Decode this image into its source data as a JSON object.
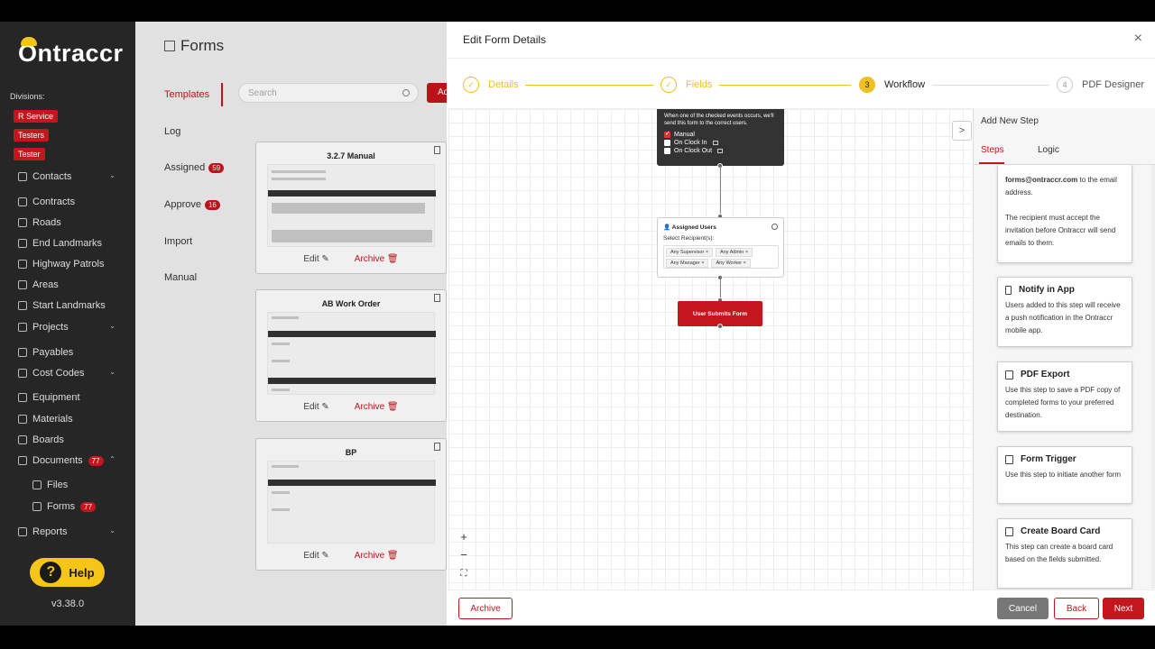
{
  "sidebar": {
    "logo": "Ontraccr",
    "divisions_label": "Divisions:",
    "divisions": [
      "R Service",
      "Testers",
      "Tester"
    ],
    "items": [
      {
        "label": "Contacts",
        "chevron": true
      },
      {
        "label": "Contracts"
      },
      {
        "label": "Roads"
      },
      {
        "label": "End Landmarks"
      },
      {
        "label": "Highway Patrols"
      },
      {
        "label": "Areas"
      },
      {
        "label": "Start Landmarks"
      },
      {
        "label": "Projects",
        "chevron": true
      },
      {
        "label": "Payables"
      },
      {
        "label": "Cost Codes",
        "chevron": true
      },
      {
        "label": "Equipment"
      },
      {
        "label": "Materials"
      },
      {
        "label": "Boards"
      },
      {
        "label": "Documents",
        "badge": "77",
        "chevron": true
      },
      {
        "label": "Files",
        "sub": true
      },
      {
        "label": "Forms",
        "badge": "77",
        "sub": true
      },
      {
        "label": "Reports",
        "chevron": true
      }
    ],
    "help_label": "Help",
    "help_q": "?",
    "version": "v3.38.0"
  },
  "forms_page": {
    "title": "Forms",
    "tabs": [
      {
        "label": "Templates",
        "active": true
      },
      {
        "label": "Log"
      },
      {
        "label": "Assigned",
        "badge": "59"
      },
      {
        "label": "Approve",
        "badge": "16"
      },
      {
        "label": "Import"
      },
      {
        "label": "Manual"
      }
    ],
    "search_placeholder": "Search",
    "add_label": "Ad",
    "cards": [
      {
        "title": "3.2.7 Manual",
        "edit": "Edit",
        "archive": "Archive"
      },
      {
        "title": "AB Work Order",
        "edit": "Edit",
        "archive": "Archive"
      },
      {
        "title": "BP",
        "edit": "Edit",
        "archive": "Archive"
      }
    ]
  },
  "modal": {
    "title": "Edit Form Details",
    "close": "×",
    "steps": [
      {
        "label": "Details",
        "marker": "✓",
        "state": "done"
      },
      {
        "label": "Fields",
        "marker": "✓",
        "state": "done"
      },
      {
        "label": "Workflow",
        "marker": "3",
        "state": "current"
      },
      {
        "label": "PDF Designer",
        "marker": "4",
        "state": "todo"
      }
    ],
    "trigger": {
      "description": "When one of the checked events occurs, we'll send this form to the correct users.",
      "options": [
        {
          "label": "Manual",
          "checked": true
        },
        {
          "label": "On Clock In",
          "checked": false
        },
        {
          "label": "On Clock Out",
          "checked": false
        }
      ]
    },
    "assigned_users": {
      "title": "Assigned Users",
      "subtitle": "Select Recipient(s):",
      "tags": [
        "Any Supervisor ×",
        "Any Admin ×",
        "Any Manager ×",
        "Any Worker ×"
      ]
    },
    "submit_node": "User Submits Form",
    "zoom": {
      "in": "+",
      "out": "−",
      "fit": "⛶"
    },
    "expand": ">",
    "side_panel": {
      "title": "Add New Step",
      "tabs": [
        "Steps",
        "Logic"
      ],
      "cards": [
        {
          "title": "",
          "desc_bold": "forms@ontraccr.com",
          "desc": " to the email address.",
          "desc2": "The recipient must accept the invitation before Ontraccr will send emails to them."
        },
        {
          "title": "Notify in App",
          "desc": "Users added to this step will receive a push notification in the Ontraccr mobile app."
        },
        {
          "title": "PDF Export",
          "desc": "Use this step to save a PDF copy of completed forms to your preferred destination."
        },
        {
          "title": "Form Trigger",
          "desc": "Use this step to initiate another form"
        },
        {
          "title": "Create Board Card",
          "desc": "This step can create a board card based on the fields submitted."
        }
      ]
    },
    "footer": {
      "archive": "Archive",
      "cancel": "Cancel",
      "back": "Back",
      "next": "Next"
    }
  }
}
